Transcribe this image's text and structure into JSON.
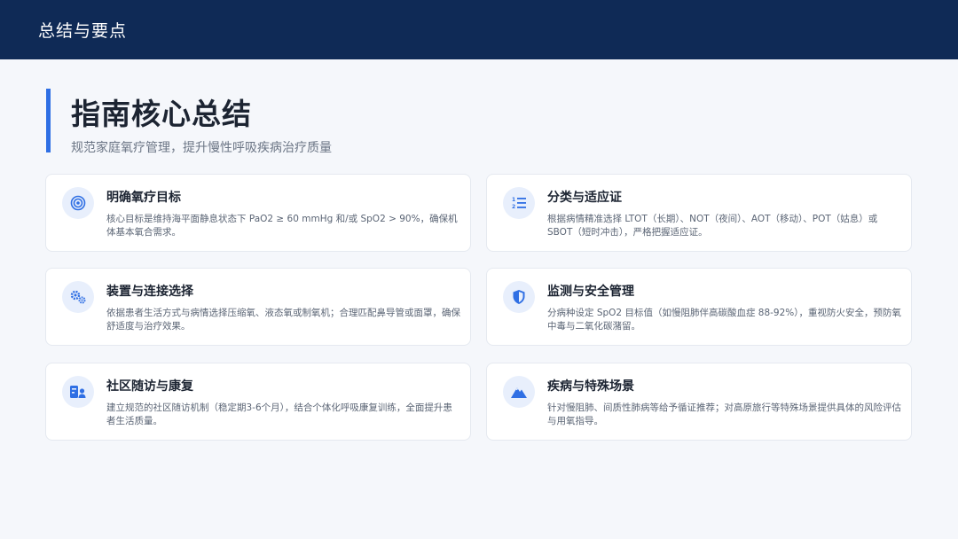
{
  "header": {
    "title": "总结与要点"
  },
  "hero": {
    "title": "指南核心总结",
    "subtitle": "规范家庭氧疗管理，提升慢性呼吸疾病治疗质量"
  },
  "accent_color": "#2f6fe4",
  "cards": [
    {
      "icon": "target-icon",
      "title": "明确氧疗目标",
      "description": "核心目标是维持海平面静息状态下 PaO2 ≥ 60 mmHg 和/或 SpO2 > 90%，确保机体基本氧合需求。"
    },
    {
      "icon": "numbered-list-icon",
      "title": "分类与适应证",
      "description": "根据病情精准选择 LTOT（长期）、NOT（夜间）、AOT（移动）、POT（姑息）或 SBOT（短时冲击），严格把握适应证。"
    },
    {
      "icon": "gears-icon",
      "title": "装置与连接选择",
      "description": "依据患者生活方式与病情选择压缩氧、液态氧或制氧机；合理匹配鼻导管或面罩，确保舒适度与治疗效果。"
    },
    {
      "icon": "shield-icon",
      "title": "监测与安全管理",
      "description": "分病种设定 SpO2 目标值（如慢阻肺伴高碳酸血症 88-92%），重视防火安全，预防氧中毒与二氧化碳潴留。"
    },
    {
      "icon": "user-card-icon",
      "title": "社区随访与康复",
      "description": "建立规范的社区随访机制（稳定期3-6个月），结合个体化呼吸康复训练，全面提升患者生活质量。"
    },
    {
      "icon": "mountain-icon",
      "title": "疾病与特殊场景",
      "description": "针对慢阻肺、间质性肺病等给予循证推荐；对高原旅行等特殊场景提供具体的风险评估与用氧指导。"
    }
  ]
}
